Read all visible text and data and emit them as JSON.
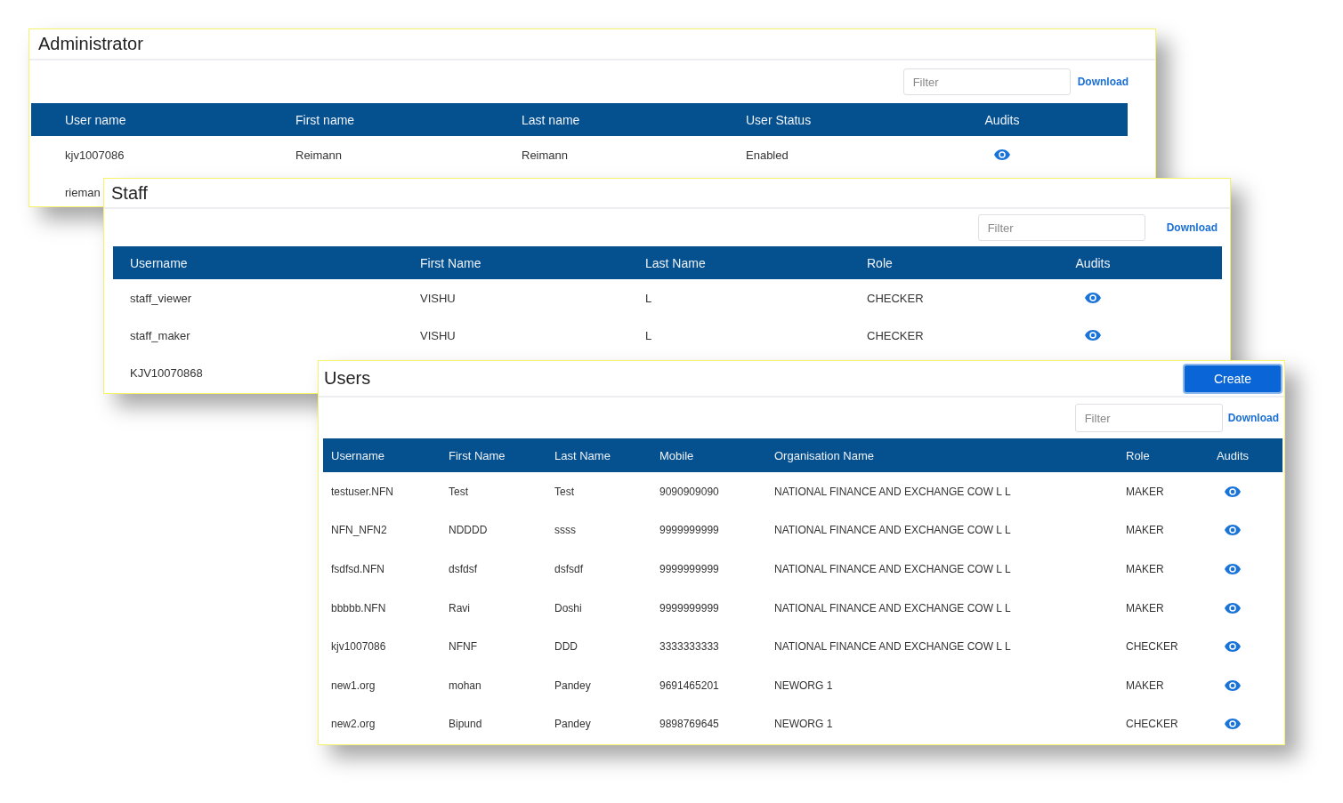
{
  "windows": [
    {
      "title": "Administrator",
      "filter": {
        "placeholder": "Filter"
      },
      "download": "Download",
      "columns": [
        "User name",
        "First name",
        "Last name",
        "User Status",
        "Audits"
      ],
      "rows": [
        {
          "cells": [
            "kjv1007086",
            "Reimann",
            "Reimann",
            "Enabled"
          ]
        },
        {
          "cells": [
            "rieman"
          ]
        }
      ]
    },
    {
      "title": "Staff",
      "filter": {
        "placeholder": "Filter"
      },
      "download": "Download",
      "columns": [
        "Username",
        "First Name",
        "Last Name",
        "Role",
        "Audits"
      ],
      "rows": [
        {
          "cells": [
            "staff_viewer",
            "VISHU",
            "L",
            "CHECKER"
          ]
        },
        {
          "cells": [
            "staff_maker",
            "VISHU",
            "L",
            "CHECKER"
          ]
        },
        {
          "cells": [
            "KJV10070868"
          ]
        }
      ]
    },
    {
      "title": "Users",
      "create_button": "Create",
      "filter": {
        "placeholder": "Filter"
      },
      "download": "Download",
      "columns": [
        "Username",
        "First Name",
        "Last Name",
        "Mobile",
        "Organisation Name",
        "Role",
        "Audits"
      ],
      "rows": [
        {
          "cells": [
            "testuser.NFN",
            "Test",
            "Test",
            "9090909090",
            "NATIONAL FINANCE AND EXCHANGE COW L L",
            "MAKER"
          ]
        },
        {
          "cells": [
            "NFN_NFN2",
            "NDDDD",
            "ssss",
            "9999999999",
            "NATIONAL FINANCE AND EXCHANGE COW L L",
            "MAKER"
          ]
        },
        {
          "cells": [
            "fsdfsd.NFN",
            "dsfdsf",
            "dsfsdf",
            "9999999999",
            "NATIONAL FINANCE AND EXCHANGE COW L L",
            "MAKER"
          ]
        },
        {
          "cells": [
            "bbbbb.NFN",
            "Ravi",
            "Doshi",
            "9999999999",
            "NATIONAL FINANCE AND EXCHANGE COW L L",
            "MAKER"
          ]
        },
        {
          "cells": [
            "kjv1007086",
            "NFNF",
            "DDD",
            "3333333333",
            "NATIONAL FINANCE AND EXCHANGE COW L L",
            "CHECKER"
          ]
        },
        {
          "cells": [
            "new1.org",
            "mohan",
            "Pandey",
            "9691465201",
            "NEWORG 1",
            "MAKER"
          ]
        },
        {
          "cells": [
            "new2.org",
            "Bipund",
            "Pandey",
            "9898769645",
            "NEWORG 1",
            "CHECKER"
          ]
        }
      ]
    }
  ]
}
